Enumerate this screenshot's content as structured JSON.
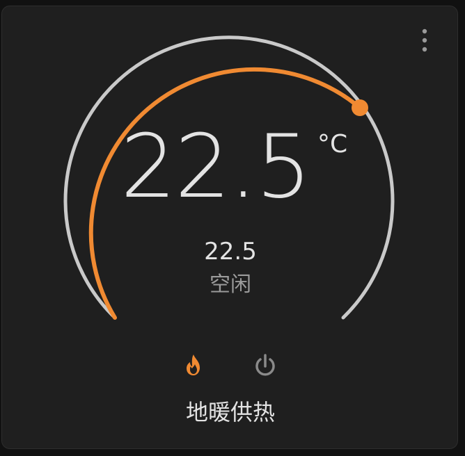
{
  "thermostat": {
    "target_temperature": "22.5",
    "unit": "°C",
    "current_temperature": "22.5",
    "status": "空闲",
    "name": "地暖供热",
    "active_mode": "heat",
    "modes": [
      {
        "id": "heat",
        "icon": "flame-icon",
        "color": "#f08a32"
      },
      {
        "id": "off",
        "icon": "power-icon",
        "color": "#8a8a8a"
      }
    ],
    "colors": {
      "accent": "#f08a32",
      "track": "#c9c9c9",
      "card": "#1f1f1f",
      "text": "#e3e3e3",
      "muted": "#9b9b9b"
    },
    "target_fraction_of_range": 0.72
  }
}
